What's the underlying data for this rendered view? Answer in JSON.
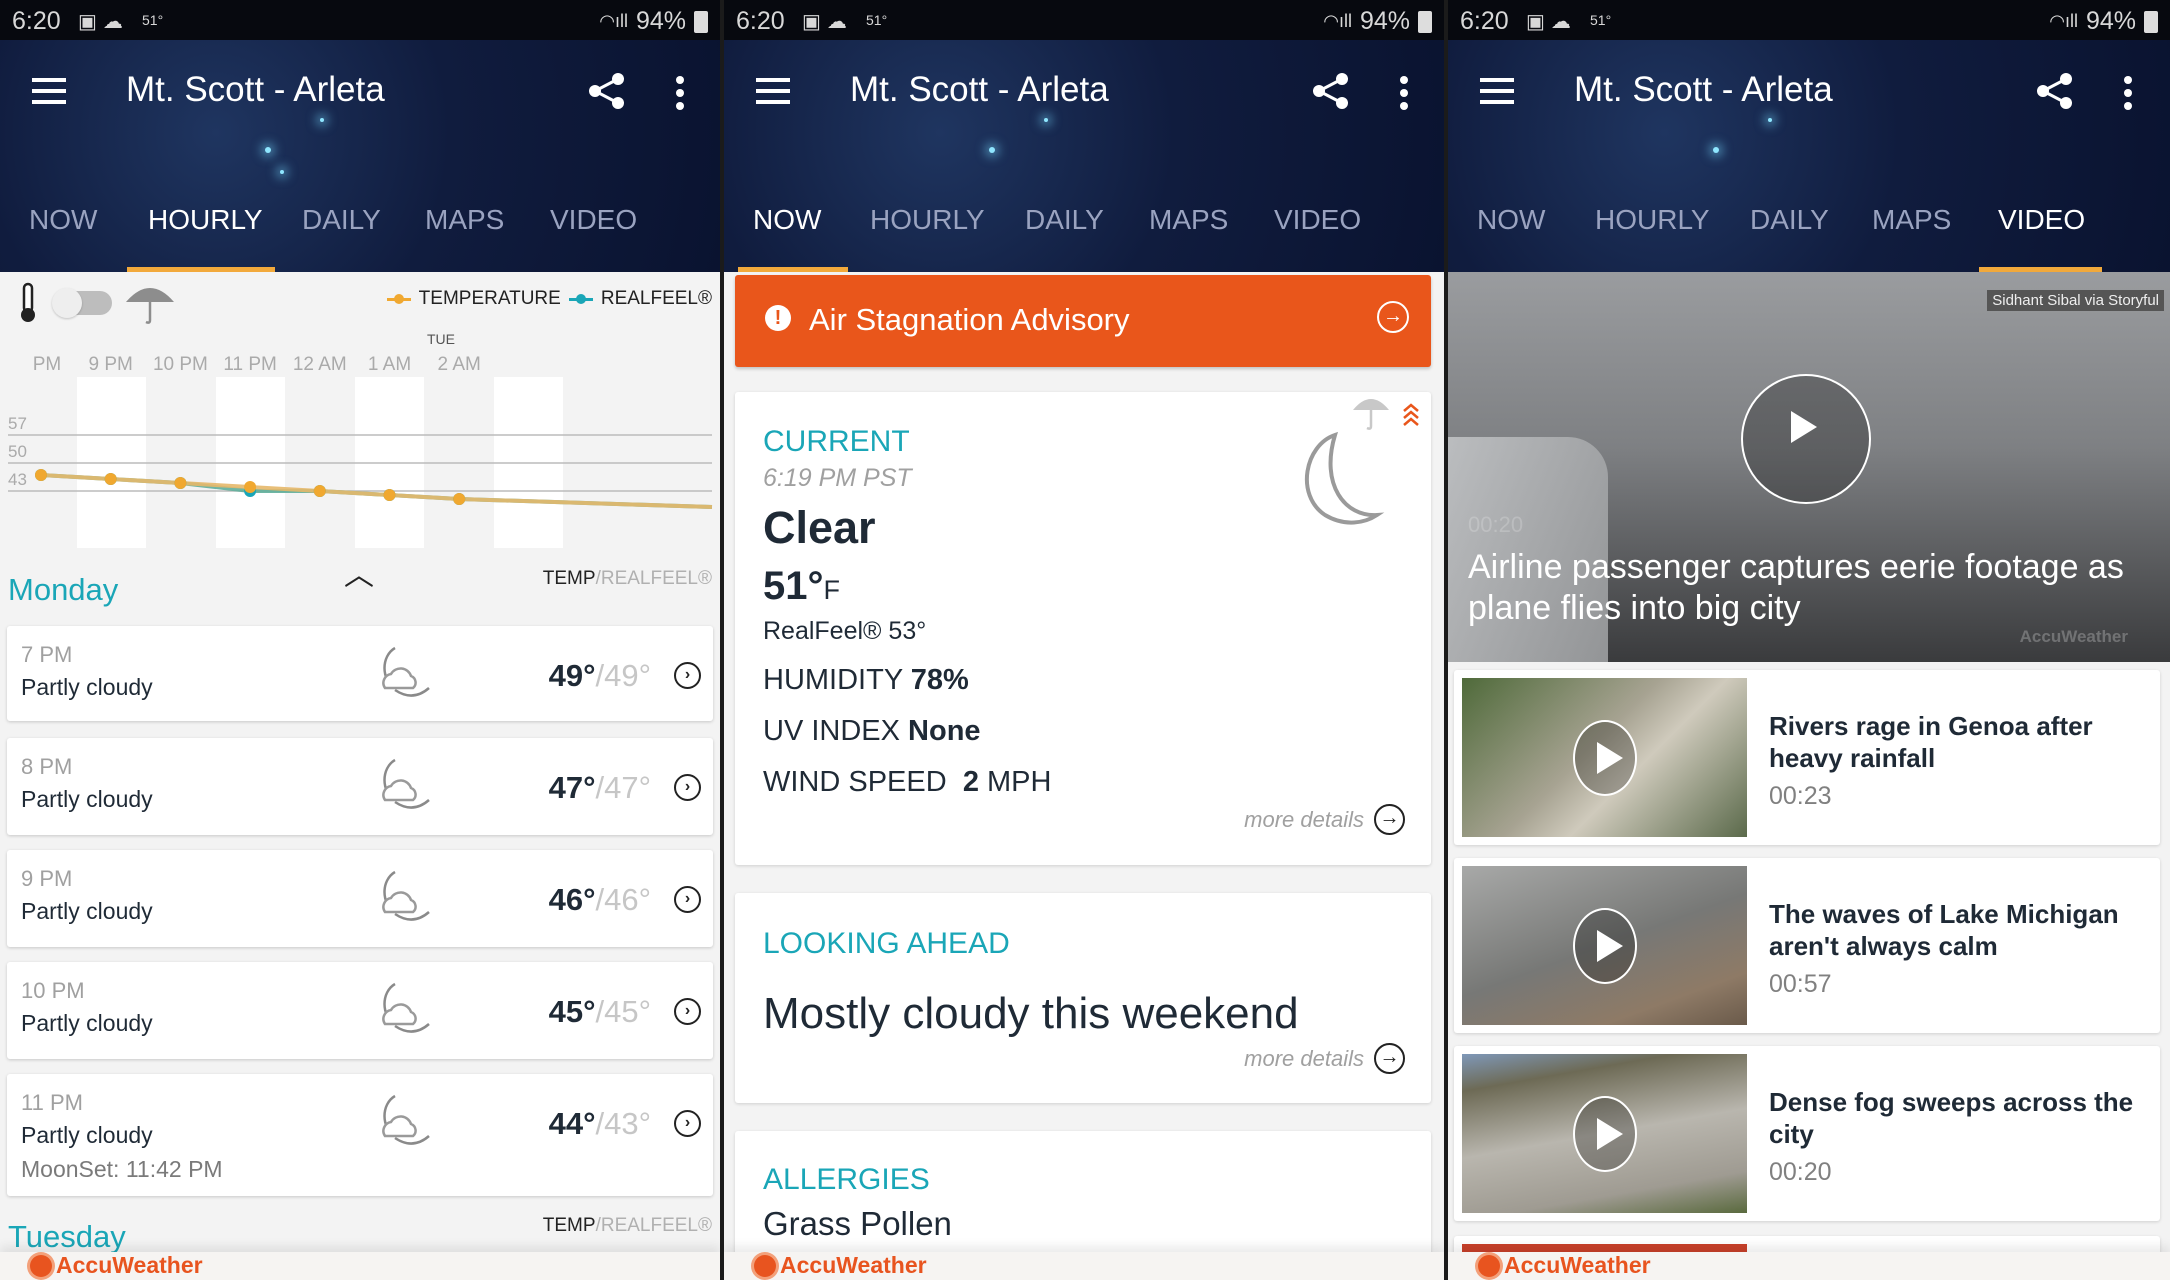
{
  "status_bar": {
    "time": "6:20",
    "weather_temp": "51°",
    "battery": "94%",
    "icons": [
      "image-icon",
      "cloud-upload-icon",
      "wifi-icon",
      "signal-icon",
      "battery-icon"
    ]
  },
  "app": {
    "location": "Mt. Scott - Arleta",
    "tabs": [
      "NOW",
      "HOURLY",
      "DAILY",
      "MAPS",
      "VIDEO"
    ],
    "brand": "AccuWeather",
    "accent": "#f2a93b",
    "teal": "#1aa6b7",
    "advisory_color": "#e9561b"
  },
  "hourly": {
    "legend": {
      "temperature": "TEMPERATURE",
      "realfeel": "REALFEEL®"
    },
    "day_marker": "TUE",
    "temp_label": "TEMP",
    "realfeel_label": "/REALFEEL®",
    "days": [
      "Monday",
      "Tuesday"
    ],
    "items": [
      {
        "time": "7 PM",
        "condition": "Partly cloudy",
        "temp": "49°",
        "realfeel": "/49°"
      },
      {
        "time": "8 PM",
        "condition": "Partly cloudy",
        "temp": "47°",
        "realfeel": "/47°"
      },
      {
        "time": "9 PM",
        "condition": "Partly cloudy",
        "temp": "46°",
        "realfeel": "/46°"
      },
      {
        "time": "10 PM",
        "condition": "Partly cloudy",
        "temp": "45°",
        "realfeel": "/45°"
      },
      {
        "time": "11 PM",
        "condition": "Partly cloudy",
        "temp": "44°",
        "realfeel": "/43°",
        "extra": "MoonSet: 11:42 PM"
      }
    ]
  },
  "chart_data": {
    "type": "line",
    "categories": [
      "PM",
      "9 PM",
      "10 PM",
      "11 PM",
      "12 AM",
      "1 AM",
      "2 AM"
    ],
    "series": [
      {
        "name": "TEMPERATURE",
        "color": "#f0a830",
        "values": [
          47,
          46,
          45,
          44,
          43,
          42,
          41
        ]
      },
      {
        "name": "REALFEEL®",
        "color": "#1aa6b7",
        "values": [
          47,
          46,
          45,
          43,
          43,
          42,
          41
        ]
      }
    ],
    "yticks": [
      57,
      50,
      43
    ],
    "grid": true,
    "legend": "top-right"
  },
  "now": {
    "advisory": "Air Stagnation Advisory",
    "current": {
      "label": "CURRENT",
      "time": "6:19 PM PST",
      "condition": "Clear",
      "temp": "51°",
      "unit": "F",
      "realfeel": "RealFeel® 53°",
      "humidity_label": "HUMIDITY",
      "humidity": "78%",
      "uv_label": "UV INDEX",
      "uv": "None",
      "wind_label": "WIND SPEED",
      "wind_value": "2",
      "wind_unit": "MPH",
      "more": "more details"
    },
    "looking_ahead": {
      "label": "LOOKING AHEAD",
      "text": "Mostly cloudy this weekend",
      "more": "more details"
    },
    "allergies": {
      "label": "ALLERGIES",
      "text": "Grass Pollen"
    }
  },
  "video": {
    "hero": {
      "credit": "Sidhant Sibal via Storyful",
      "duration": "00:20",
      "title": "Airline passenger captures eerie footage as plane flies into big city",
      "watermark": "AccuWeather"
    },
    "items": [
      {
        "title": "Rivers rage in Genoa after heavy rainfall",
        "duration": "00:23"
      },
      {
        "title": "The waves of Lake Michigan aren't always calm",
        "duration": "00:57"
      },
      {
        "title": "Dense fog sweeps across the city",
        "duration": "00:20"
      }
    ]
  }
}
